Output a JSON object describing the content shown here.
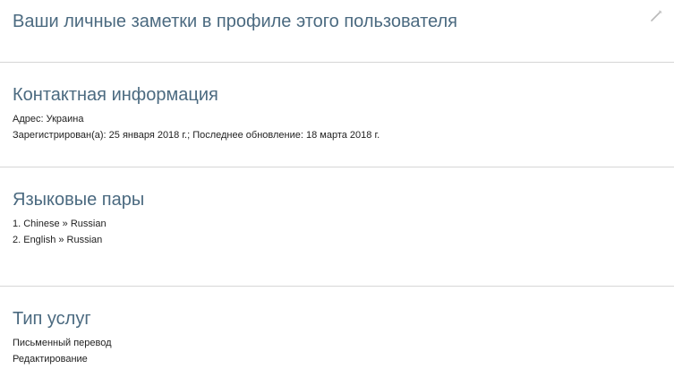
{
  "notes": {
    "title": "Ваши личные заметки в профиле этого пользователя",
    "edit_icon": "pencil-icon"
  },
  "contact": {
    "title": "Контактная информация",
    "address": "Адрес: Украина",
    "registered": "Зарегистрирован(а): 25 января 2018 г.; Последнее обновление: 18 марта 2018 г."
  },
  "languages": {
    "title": "Языковые пары",
    "pairs": [
      "1. Chinese » Russian",
      "2. English » Russian"
    ]
  },
  "services": {
    "title": "Тип услуг",
    "items": [
      "Письменный перевод",
      "Редактирование"
    ]
  },
  "colors": {
    "heading": "#4b6a80",
    "divider": "#d6d6d6",
    "text": "#222222"
  }
}
